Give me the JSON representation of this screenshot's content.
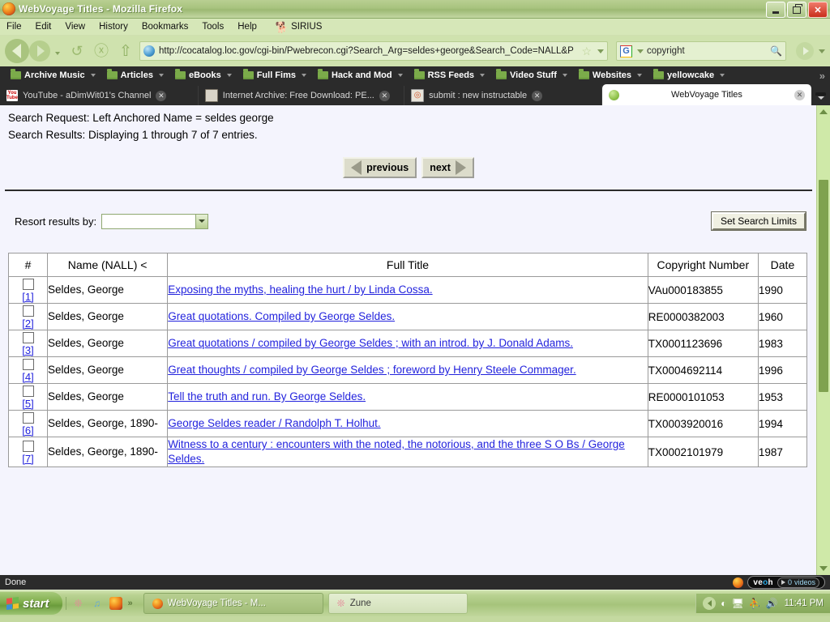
{
  "window": {
    "title": "WebVoyage Titles - Mozilla Firefox",
    "minimize": "_",
    "maximize": "□",
    "close": "✕"
  },
  "menubar": {
    "items": [
      "File",
      "Edit",
      "View",
      "History",
      "Bookmarks",
      "Tools",
      "Help"
    ],
    "extra": "SIRIUS"
  },
  "toolbar": {
    "url": "http://cocatalog.loc.gov/cgi-bin/Pwebrecon.cgi?Search_Arg=seldes+george&Search_Code=NALL&P",
    "search_value": "copyright",
    "search_engine": "G",
    "star": "☆",
    "magnifier": "🔍",
    "back_title": "Back",
    "forward_title": "Forward",
    "reload": "↺",
    "stop": "✕",
    "home": "⌂"
  },
  "bookmarks": {
    "items": [
      "Archive Music",
      "Articles",
      "eBooks",
      "Full Fims",
      "Hack and Mod",
      "RSS Feeds",
      "Video Stuff",
      "Websites",
      "yellowcake"
    ],
    "overflow": "»"
  },
  "tabs": [
    {
      "label": "YouTube - aDimWit01's Channel",
      "icon": "youtube-icon",
      "icon_text": "You Tube",
      "close": "✕",
      "active": false
    },
    {
      "label": "Internet Archive: Free Download: PE...",
      "icon": "archive-icon",
      "close": "✕",
      "active": false
    },
    {
      "label": "submit : new instructable",
      "icon": "instructables-icon",
      "icon_text": "◎",
      "close": "✕",
      "active": false
    },
    {
      "label": "WebVoyage Titles",
      "icon": "green-dot-icon",
      "close": "✕",
      "active": true
    }
  ],
  "page": {
    "search_request": "Search Request: Left Anchored Name = seldes george",
    "search_results": "Search Results: Displaying 1 through 7 of 7 entries.",
    "previous_label": "previous",
    "next_label": "next",
    "resort_label": "Resort results by:",
    "resort_value": "",
    "set_search_limits": "Set Search Limits",
    "table": {
      "headers": [
        "#",
        "Name (NALL) <",
        "Full Title",
        "Copyright Number",
        "Date"
      ],
      "rows": [
        {
          "num": "[1]",
          "name": "Seldes, George",
          "title": "Exposing the myths, healing the hurt / by Linda Cossa.",
          "copyright": "VAu000183855",
          "date": "1990"
        },
        {
          "num": "[2]",
          "name": "Seldes, George",
          "title": "Great quotations. Compiled by George Seldes.",
          "copyright": "RE0000382003",
          "date": "1960"
        },
        {
          "num": "[3]",
          "name": "Seldes, George",
          "title": "Great quotations / compiled by George Seldes ; with an introd. by J. Donald Adams.",
          "copyright": "TX0001123696",
          "date": "1983"
        },
        {
          "num": "[4]",
          "name": "Seldes, George",
          "title": "Great thoughts / compiled by George Seldes ; foreword by Henry Steele Commager.",
          "copyright": "TX0004692114",
          "date": "1996"
        },
        {
          "num": "[5]",
          "name": "Seldes, George",
          "title": "Tell the truth and run. By George Seldes.",
          "copyright": "RE0000101053",
          "date": "1953"
        },
        {
          "num": "[6]",
          "name": "Seldes, George, 1890-",
          "title": "George Seldes reader / Randolph T. Holhut.",
          "copyright": "TX0003920016",
          "date": "1994"
        },
        {
          "num": "[7]",
          "name": "Seldes, George, 1890-",
          "title": "Witness to a century : encounters with the noted, the notorious, and the three S O Bs / George Seldes.",
          "copyright": "TX0002101979",
          "date": "1987"
        }
      ]
    }
  },
  "statusbar": {
    "text": "Done",
    "veoh_brand": "veoh",
    "veoh_count": "0",
    "veoh_unit": "videos"
  },
  "taskbar": {
    "start": "start",
    "quicklaunch_overflow": "»",
    "items": [
      {
        "label": "WebVoyage Titles - M...",
        "active": true
      },
      {
        "label": "Zune",
        "active": false
      }
    ],
    "clock": "11:41 PM"
  }
}
